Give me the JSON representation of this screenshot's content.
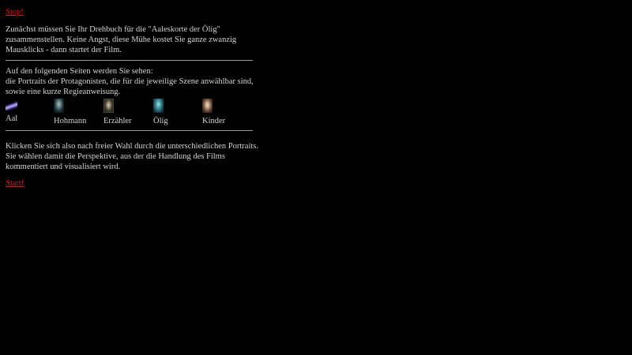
{
  "nav": {
    "stop_label": "Stop!",
    "start_label": "Start!"
  },
  "intro": {
    "text": "Zunächst müssen Sie Ihr Drehbuch für die \"Aaleskorte der Ölig\" zusammenstellen. Keine Angst, diese Mühe kostet Sie ganze zwanzig Mausklicks - dann startet der Film."
  },
  "portraits_info": {
    "line1": "Auf den folgenden Seiten werden Sie sehen:",
    "line2": "die Portraits der Protagonisten, die für die jeweilige Szene anwählbar sind, sowie eine kurze Regieanweisung."
  },
  "portraits": [
    {
      "name": "Aal",
      "icon": "eel-portrait-icon"
    },
    {
      "name": "Hohmann",
      "icon": "hohmann-portrait-icon"
    },
    {
      "name": "Erzähler",
      "icon": "narrator-portrait-icon"
    },
    {
      "name": "Ölig",
      "icon": "oelig-portrait-icon"
    },
    {
      "name": "Kinder",
      "icon": "children-portrait-icon"
    }
  ],
  "instructions": {
    "text": "Klicken Sie sich also nach freier Wahl durch die unterschiedlichen Portraits. Sie wählen damit die Perspektive, aus der die Handlung des Films kommentiert und visualisiert wird."
  },
  "colors": {
    "background": "#000000",
    "text": "#d4d4d4",
    "link": "#e0161b",
    "rule": "#9a9a9a"
  }
}
